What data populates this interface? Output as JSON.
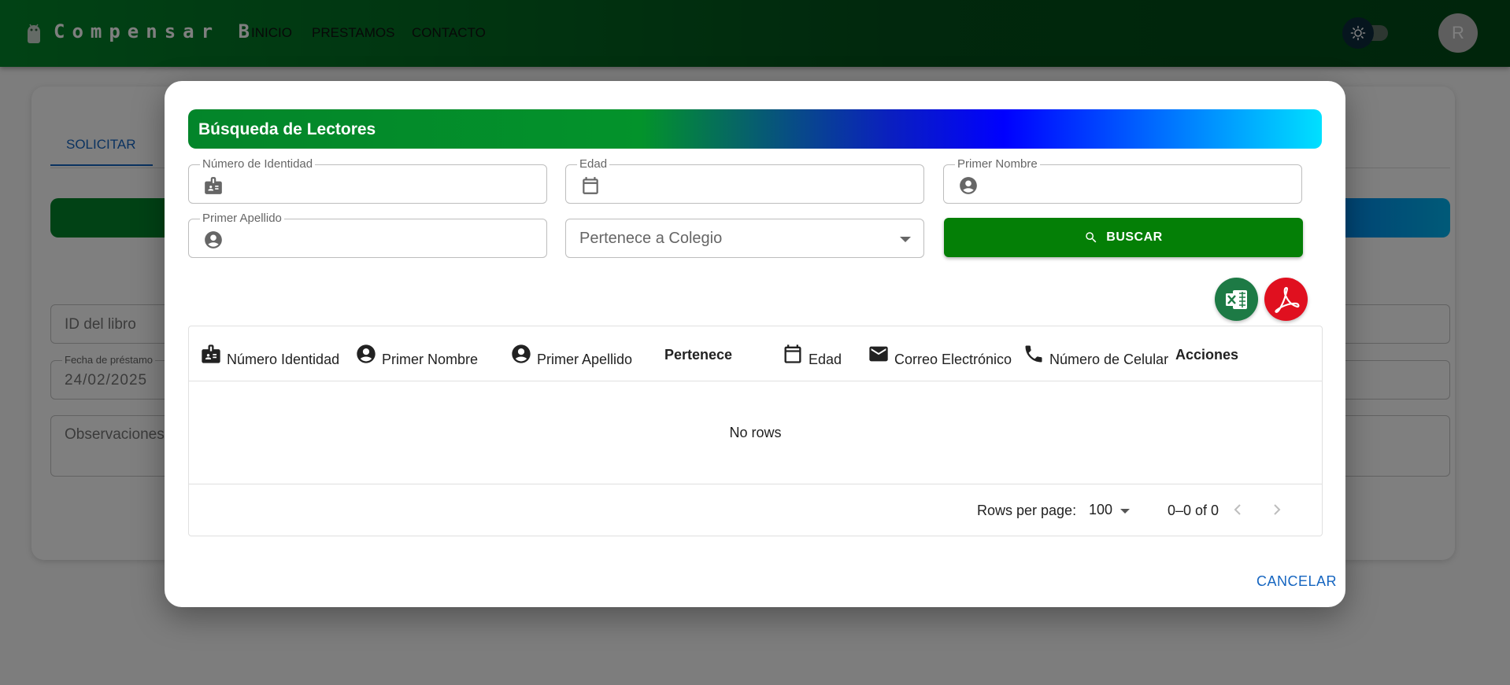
{
  "appbar": {
    "brand": "Compensar B",
    "nav": [
      "INICIO",
      "PRESTAMOS",
      "CONTACTO"
    ],
    "avatar_initial": "R",
    "theme_toggle_icon": "sun-icon"
  },
  "background_page": {
    "tab": "SOLICITAR",
    "book_id_placeholder": "ID del libro",
    "loan_date_label": "Fecha de préstamo",
    "loan_date_value": "24/02/2025",
    "observations_placeholder": "Observaciones"
  },
  "dialog": {
    "title": "Búsqueda de Lectores",
    "fields": {
      "identity_label": "Número de Identidad",
      "age_label": "Edad",
      "first_name_label": "Primer Nombre",
      "last_name_label": "Primer Apellido",
      "school_placeholder": "Pertenece a Colegio"
    },
    "search_button": "BUSCAR",
    "export_excel_icon": "excel-icon",
    "export_pdf_icon": "pdf-icon",
    "table": {
      "columns": [
        "Número Identidad",
        "Primer Nombre",
        "Primer Apellido",
        "Pertenece",
        "Edad",
        "Correo Electrónico",
        "Número de Celular",
        "Acciones"
      ],
      "empty_text": "No rows",
      "rows_per_page_label": "Rows per page:",
      "rows_per_page_value": "100",
      "pagination_text": "0–0 of 0"
    },
    "cancel_button": "CANCELAR"
  },
  "colors": {
    "appbar_green": "#03852a",
    "search_button": "#047f06",
    "link_blue": "#1565c0",
    "excel_green": "#1d7a45",
    "pdf_red": "#e0101f"
  }
}
